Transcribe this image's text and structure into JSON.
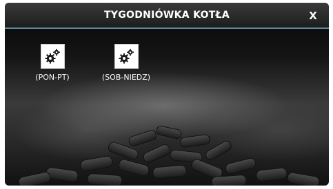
{
  "window": {
    "title": "TYGODNIÓWKA KOTŁA",
    "close_label": "X"
  },
  "buttons": [
    {
      "label": "(PON-PT)",
      "icon": "gears-icon"
    },
    {
      "label": "(SOB-NIEDZ)",
      "icon": "gears-icon"
    }
  ],
  "colors": {
    "title_bar": "#2a2a2a",
    "accent_line": "#5d8a9a",
    "tile": "#ffffff",
    "icon": "#1a1a1a",
    "text": "#ffffff"
  }
}
